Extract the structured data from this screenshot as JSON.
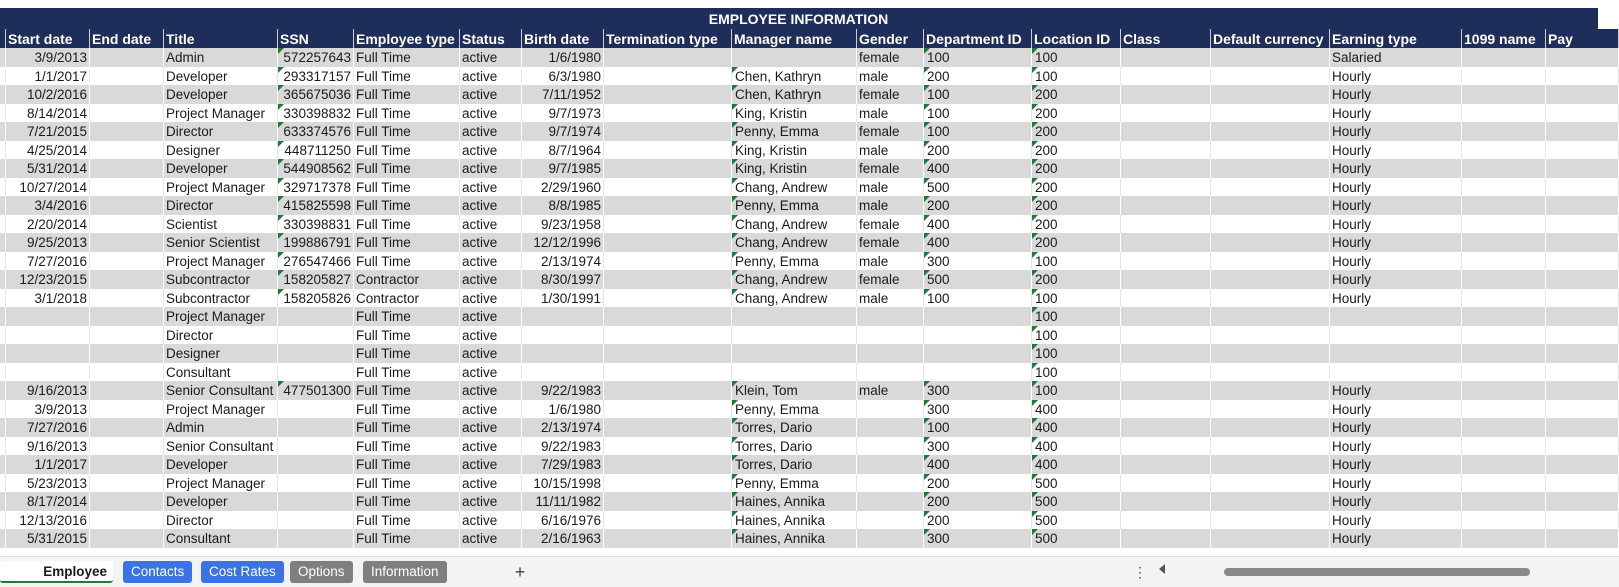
{
  "sheet_title": "EMPLOYEE INFORMATION",
  "columns": [
    "",
    "Start date",
    "End date",
    "Title",
    "SSN",
    "Employee type",
    "Status",
    "Birth date",
    "Termination type",
    "Manager name",
    "Gender",
    "Department ID",
    "Location ID",
    "Class",
    "Default currency",
    "Earning type",
    "1099 name",
    "Pay"
  ],
  "rows": [
    [
      "",
      "3/9/2013",
      "",
      "Admin",
      "572257643",
      "Full Time",
      "active",
      "1/6/1980",
      "",
      "",
      "female",
      "100",
      "100",
      "",
      "",
      "Salaried",
      "",
      ""
    ],
    [
      "",
      "1/1/2017",
      "",
      "Developer",
      "293317157",
      "Full Time",
      "active",
      "6/3/1980",
      "",
      "Chen, Kathryn",
      "male",
      "200",
      "100",
      "",
      "",
      "Hourly",
      "",
      ""
    ],
    [
      "",
      "10/2/2016",
      "",
      "Developer",
      "365675036",
      "Full Time",
      "active",
      "7/11/1952",
      "",
      "Chen, Kathryn",
      "female",
      "100",
      "200",
      "",
      "",
      "Hourly",
      "",
      ""
    ],
    [
      "",
      "8/14/2014",
      "",
      "Project Manager",
      "330398832",
      "Full Time",
      "active",
      "9/7/1973",
      "",
      "King, Kristin",
      "male",
      "100",
      "200",
      "",
      "",
      "Hourly",
      "",
      ""
    ],
    [
      "",
      "7/21/2015",
      "",
      "Director",
      "633374576",
      "Full Time",
      "active",
      "9/7/1974",
      "",
      "Penny, Emma",
      "female",
      "100",
      "200",
      "",
      "",
      "Hourly",
      "",
      ""
    ],
    [
      "",
      "4/25/2014",
      "",
      "Designer",
      "448711250",
      "Full Time",
      "active",
      "8/7/1964",
      "",
      "King, Kristin",
      "male",
      "200",
      "200",
      "",
      "",
      "Hourly",
      "",
      ""
    ],
    [
      "",
      "5/31/2014",
      "",
      "Developer",
      "544908562",
      "Full Time",
      "active",
      "9/7/1985",
      "",
      "King, Kristin",
      "female",
      "400",
      "200",
      "",
      "",
      "Hourly",
      "",
      ""
    ],
    [
      "",
      "10/27/2014",
      "",
      "Project Manager",
      "329717378",
      "Full Time",
      "active",
      "2/29/1960",
      "",
      "Chang, Andrew",
      "male",
      "500",
      "200",
      "",
      "",
      "Hourly",
      "",
      ""
    ],
    [
      "",
      "3/4/2016",
      "",
      "Director",
      "415825598",
      "Full Time",
      "active",
      "8/8/1985",
      "",
      "Penny, Emma",
      "male",
      "200",
      "200",
      "",
      "",
      "Hourly",
      "",
      ""
    ],
    [
      "",
      "2/20/2014",
      "",
      "Scientist",
      "330398831",
      "Full Time",
      "active",
      "9/23/1958",
      "",
      "Chang, Andrew",
      "female",
      "400",
      "200",
      "",
      "",
      "Hourly",
      "",
      ""
    ],
    [
      "",
      "9/25/2013",
      "",
      "Senior Scientist",
      "199886791",
      "Full Time",
      "active",
      "12/12/1996",
      "",
      "Chang, Andrew",
      "female",
      "400",
      "200",
      "",
      "",
      "Hourly",
      "",
      ""
    ],
    [
      "",
      "7/27/2016",
      "",
      "Project Manager",
      "276547466",
      "Full Time",
      "active",
      "2/13/1974",
      "",
      "Penny, Emma",
      "male",
      "300",
      "100",
      "",
      "",
      "Hourly",
      "",
      ""
    ],
    [
      "",
      "12/23/2015",
      "",
      "Subcontractor",
      "158205827",
      "Contractor",
      "active",
      "8/30/1997",
      "",
      "Chang, Andrew",
      "female",
      "500",
      "200",
      "",
      "",
      "Hourly",
      "",
      ""
    ],
    [
      "",
      "3/1/2018",
      "",
      "Subcontractor",
      "158205826",
      "Contractor",
      "active",
      "1/30/1991",
      "",
      "Chang, Andrew",
      "male",
      "100",
      "100",
      "",
      "",
      "Hourly",
      "",
      ""
    ],
    [
      "",
      "",
      "",
      "Project Manager",
      "",
      "Full Time",
      "active",
      "",
      "",
      "",
      "",
      "",
      "100",
      "",
      "",
      "",
      "",
      ""
    ],
    [
      "",
      "",
      "",
      "Director",
      "",
      "Full Time",
      "active",
      "",
      "",
      "",
      "",
      "",
      "100",
      "",
      "",
      "",
      "",
      ""
    ],
    [
      "",
      "",
      "",
      "Designer",
      "",
      "Full Time",
      "active",
      "",
      "",
      "",
      "",
      "",
      "100",
      "",
      "",
      "",
      "",
      ""
    ],
    [
      "",
      "",
      "",
      "Consultant",
      "",
      "Full Time",
      "active",
      "",
      "",
      "",
      "",
      "",
      "100",
      "",
      "",
      "",
      "",
      ""
    ],
    [
      "",
      "9/16/2013",
      "",
      "Senior Consultant",
      "477501300",
      "Full Time",
      "active",
      "9/22/1983",
      "",
      "Klein, Tom",
      "male",
      "300",
      "100",
      "",
      "",
      "Hourly",
      "",
      ""
    ],
    [
      "",
      "3/9/2013",
      "",
      "Project Manager",
      "",
      "Full Time",
      "active",
      "1/6/1980",
      "",
      "Penny, Emma",
      "",
      "300",
      "400",
      "",
      "",
      "Hourly",
      "",
      ""
    ],
    [
      "",
      "7/27/2016",
      "",
      "Admin",
      "",
      "Full Time",
      "active",
      "2/13/1974",
      "",
      "Torres, Dario",
      "",
      "100",
      "400",
      "",
      "",
      "Hourly",
      "",
      ""
    ],
    [
      "",
      "9/16/2013",
      "",
      "Senior Consultant",
      "",
      "Full Time",
      "active",
      "9/22/1983",
      "",
      "Torres, Dario",
      "",
      "300",
      "400",
      "",
      "",
      "Hourly",
      "",
      ""
    ],
    [
      "",
      "1/1/2017",
      "",
      "Developer",
      "",
      "Full Time",
      "active",
      "7/29/1983",
      "",
      "Torres, Dario",
      "",
      "400",
      "400",
      "",
      "",
      "Hourly",
      "",
      ""
    ],
    [
      "",
      "5/23/2013",
      "",
      "Project Manager",
      "",
      "Full Time",
      "active",
      "10/15/1998",
      "",
      "Penny, Emma",
      "",
      "200",
      "500",
      "",
      "",
      "Hourly",
      "",
      ""
    ],
    [
      "",
      "8/17/2014",
      "",
      "Developer",
      "",
      "Full Time",
      "active",
      "11/11/1982",
      "",
      "Haines, Annika",
      "",
      "200",
      "500",
      "",
      "",
      "Hourly",
      "",
      ""
    ],
    [
      "",
      "12/13/2016",
      "",
      "Director",
      "",
      "Full Time",
      "active",
      "6/16/1976",
      "",
      "Haines, Annika",
      "",
      "200",
      "500",
      "",
      "",
      "Hourly",
      "",
      ""
    ],
    [
      "",
      "5/31/2015",
      "",
      "Consultant",
      "",
      "Full Time",
      "active",
      "2/16/1963",
      "",
      "Haines, Annika",
      "",
      "300",
      "500",
      "",
      "",
      "Hourly",
      "",
      ""
    ]
  ],
  "tabs": {
    "active": "Employee Information",
    "others": [
      {
        "label": "Contacts",
        "color": "#3b73e6"
      },
      {
        "label": "Cost Rates",
        "color": "#3b73e6"
      },
      {
        "label": "Options",
        "color": "#7f7f7f"
      },
      {
        "label": "Information",
        "color": "#7f7f7f"
      }
    ],
    "add_label": "+",
    "more_label": "⋮"
  },
  "colors": {
    "header_bg": "#1f2d5a",
    "band_bg": "#d9d9d9",
    "flag": "#1e7b34",
    "active_tab_underline": "#1d7a3a"
  }
}
